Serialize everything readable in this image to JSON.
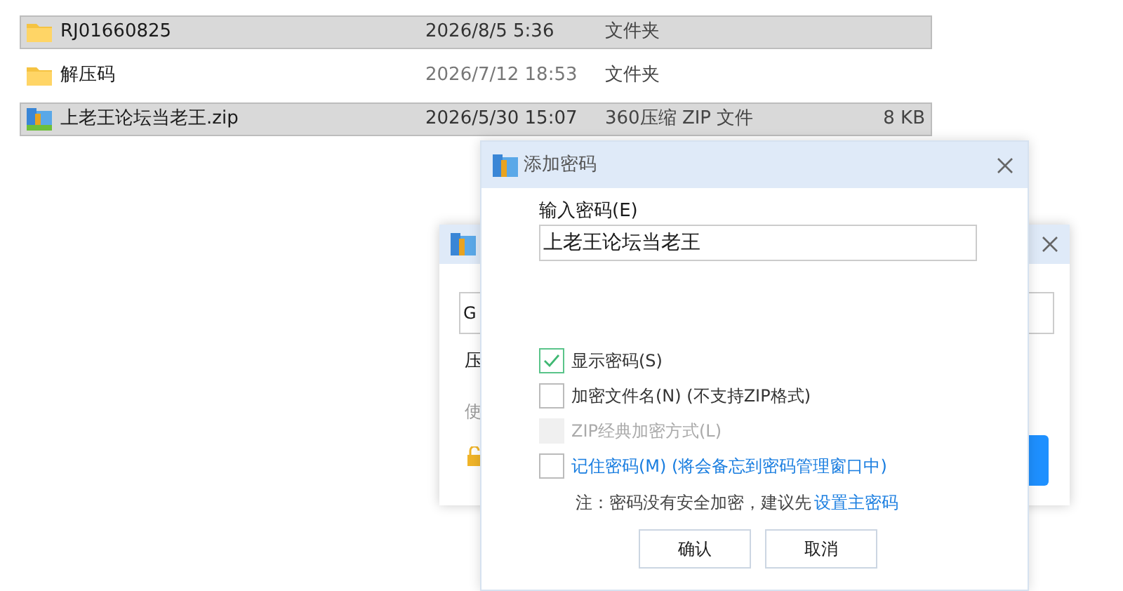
{
  "files": [
    {
      "kind": "folder",
      "name": "RJ01660825",
      "date": "2026/8/5 5:36",
      "type": "文件夹",
      "selected": true
    },
    {
      "kind": "folder",
      "name": "解压码",
      "date": "2026/7/12 18:53",
      "type": "文件夹",
      "selected": false
    },
    {
      "kind": "zip",
      "name": "上老王论坛当老王.zip",
      "date": "2026/5/30 15:07",
      "type": "360压缩 ZIP 文件",
      "size": "8 KB",
      "selected": true
    }
  ],
  "background_dialog": {
    "field_value": "G",
    "label": "压",
    "hint": "使"
  },
  "dialog": {
    "title": "添加密码",
    "password_label": "输入密码(E)",
    "password_value": "上老王论坛当老王",
    "options": [
      {
        "kind": "plain",
        "label": "显示密码(S)",
        "checked": true,
        "disabled": false
      },
      {
        "kind": "plain",
        "label": "加密文件名(N) (不支持ZIP格式)",
        "checked": false,
        "disabled": false
      },
      {
        "kind": "plain",
        "label": "ZIP经典加密方式(L)",
        "checked": false,
        "disabled": true
      },
      {
        "kind": "link",
        "label": "记住密码(M) (将会备忘到密码管理窗口中)",
        "checked": false,
        "disabled": false
      }
    ],
    "note": "注：密码没有安全加密，建议先",
    "note_link": "设置主密码",
    "buttons": [
      "确认",
      "取消"
    ]
  }
}
